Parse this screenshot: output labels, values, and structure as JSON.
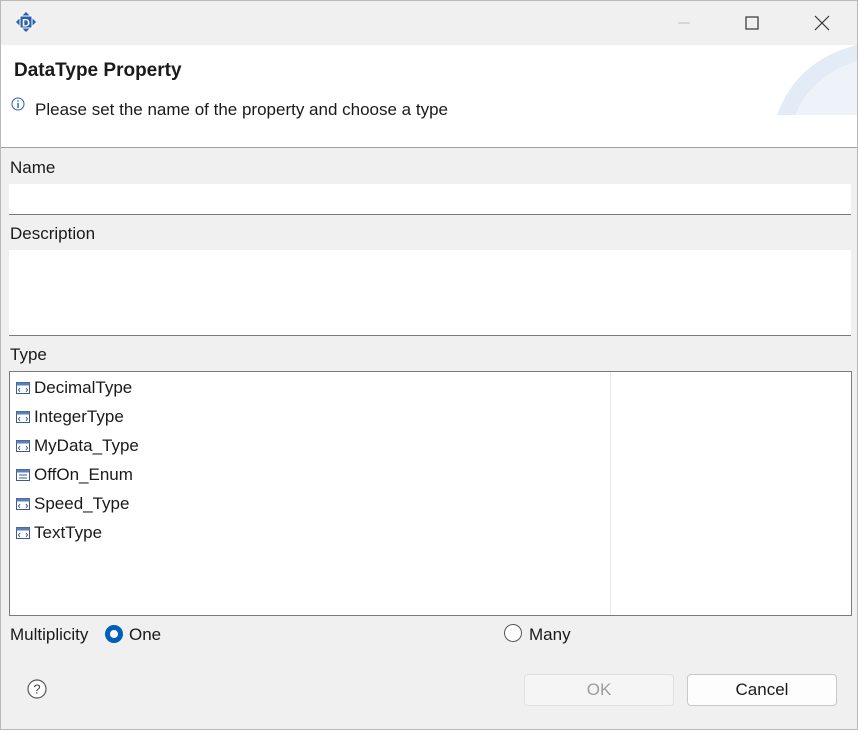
{
  "window": {
    "app_icon": "d-app-icon",
    "controls": [
      "minimize-icon",
      "maximize-icon",
      "close-icon"
    ]
  },
  "header": {
    "title": "DataType Property",
    "message": "Please set the name of the property and choose a type",
    "info_icon": "info-icon"
  },
  "form": {
    "name_label": "Name",
    "name_value": "",
    "description_label": "Description",
    "description_value": "",
    "type_label": "Type",
    "types": [
      "DecimalType",
      "IntegerType",
      "MyData_Type",
      "OffOn_Enum",
      "Speed_Type",
      "TextType"
    ],
    "multiplicity_label": "Multiplicity",
    "multiplicity_options": [
      {
        "label": "One",
        "selected": true
      },
      {
        "label": "Many",
        "selected": false
      }
    ]
  },
  "buttons": {
    "ok_label": "OK",
    "ok_enabled": false,
    "cancel_label": "Cancel",
    "help_icon": "help-icon"
  },
  "colors": {
    "accent": "#005fb8",
    "app_icon_blue": "#2b5fad"
  }
}
